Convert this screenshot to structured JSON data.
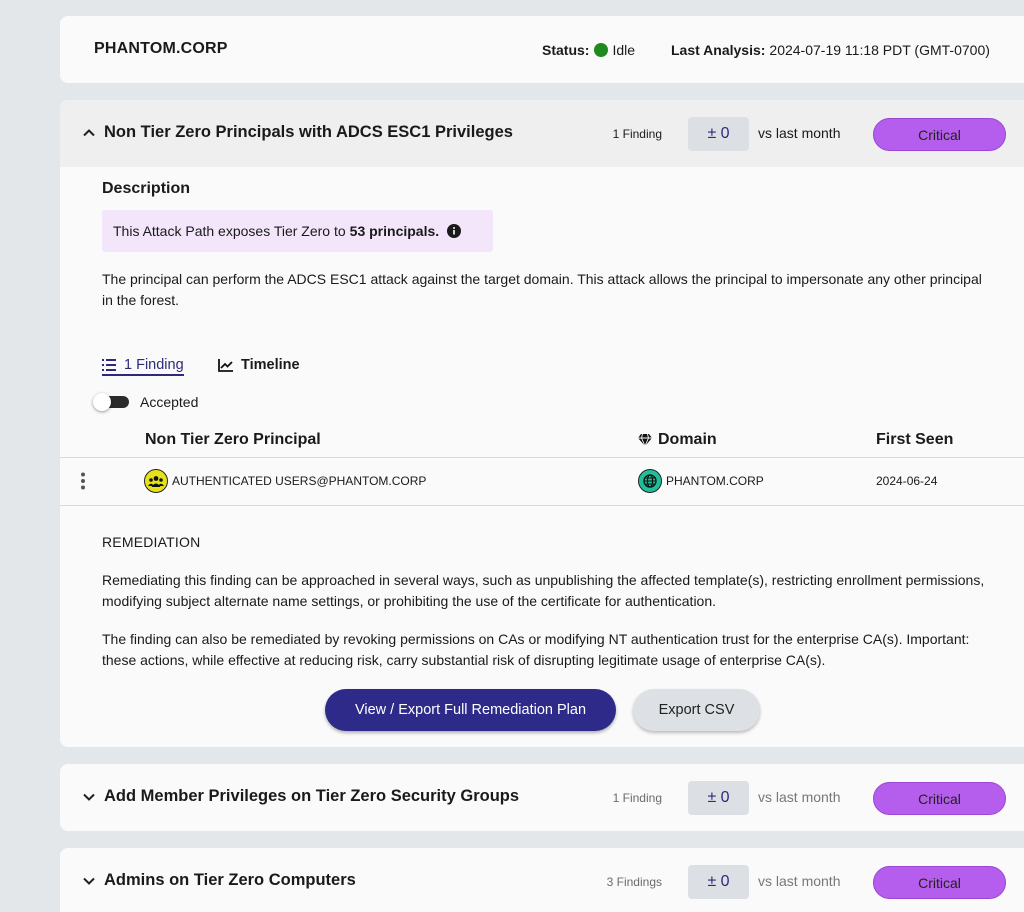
{
  "header": {
    "domain": "PHANTOM.CORP",
    "status_label": "Status:",
    "status_value": "Idle",
    "status_color": "#1f8a1f",
    "analysis_label": "Last Analysis:",
    "analysis_value": "2024-07-19 11:18 PDT (GMT-0700)"
  },
  "findings": [
    {
      "title": "Non Tier Zero Principals with ADCS ESC1 Privileges",
      "count": "1 Finding",
      "delta": "± 0",
      "vs": "vs last month",
      "severity": "Critical",
      "expanded": true,
      "description": {
        "title": "Description",
        "exposure_prefix": "This Attack Path exposes Tier Zero to",
        "exposure_value": "53 principals.",
        "text": "The principal can perform the ADCS ESC1 attack against the target domain. This attack allows the principal to impersonate any other principal in the forest."
      },
      "tabs": [
        "1 Finding",
        "Timeline"
      ],
      "accepted_label": "Accepted",
      "table": {
        "columns": [
          "Non Tier Zero Principal",
          "Domain",
          "First Seen"
        ],
        "rows": [
          {
            "principal": "AUTHENTICATED USERS@PHANTOM.CORP",
            "domain": "PHANTOM.CORP",
            "first_seen": "2024-06-24"
          }
        ]
      },
      "remediation": {
        "title": "REMEDIATION",
        "paragraphs": [
          "Remediating this finding can be approached in several ways, such as unpublishing the affected template(s), restricting enrollment permissions, modifying subject alternate name settings, or prohibiting the use of the certificate for authentication.",
          "The finding can also be remediated by revoking permissions on CAs or modifying NT authentication trust for the enterprise CA(s). Important: these actions, while effective at reducing risk, carry substantial risk of disrupting legitimate usage of enterprise CA(s)."
        ],
        "primary_button": "View / Export Full Remediation Plan",
        "secondary_button": "Export CSV"
      }
    },
    {
      "title": "Add Member Privileges on Tier Zero Security Groups",
      "count": "1 Finding",
      "delta": "± 0",
      "vs": "vs last month",
      "severity": "Critical",
      "expanded": false
    },
    {
      "title": "Admins on Tier Zero Computers",
      "count": "3 Findings",
      "delta": "± 0",
      "vs": "vs last month",
      "severity": "Critical",
      "expanded": false
    }
  ],
  "colors": {
    "critical": "#b55ded",
    "primary_button": "#2e2a8a",
    "accent": "#2e2a7a",
    "exposure_bg": "#f3e6fb"
  },
  "icons": {
    "expand": "chevron-up-icon",
    "collapse": "chevron-down-icon",
    "info": "info-icon",
    "list": "list-icon",
    "timeline": "chart-line-icon",
    "domain_column": "gem-icon",
    "group": "group-icon",
    "globe": "globe-icon",
    "row_menu": "kebab-menu-icon"
  }
}
